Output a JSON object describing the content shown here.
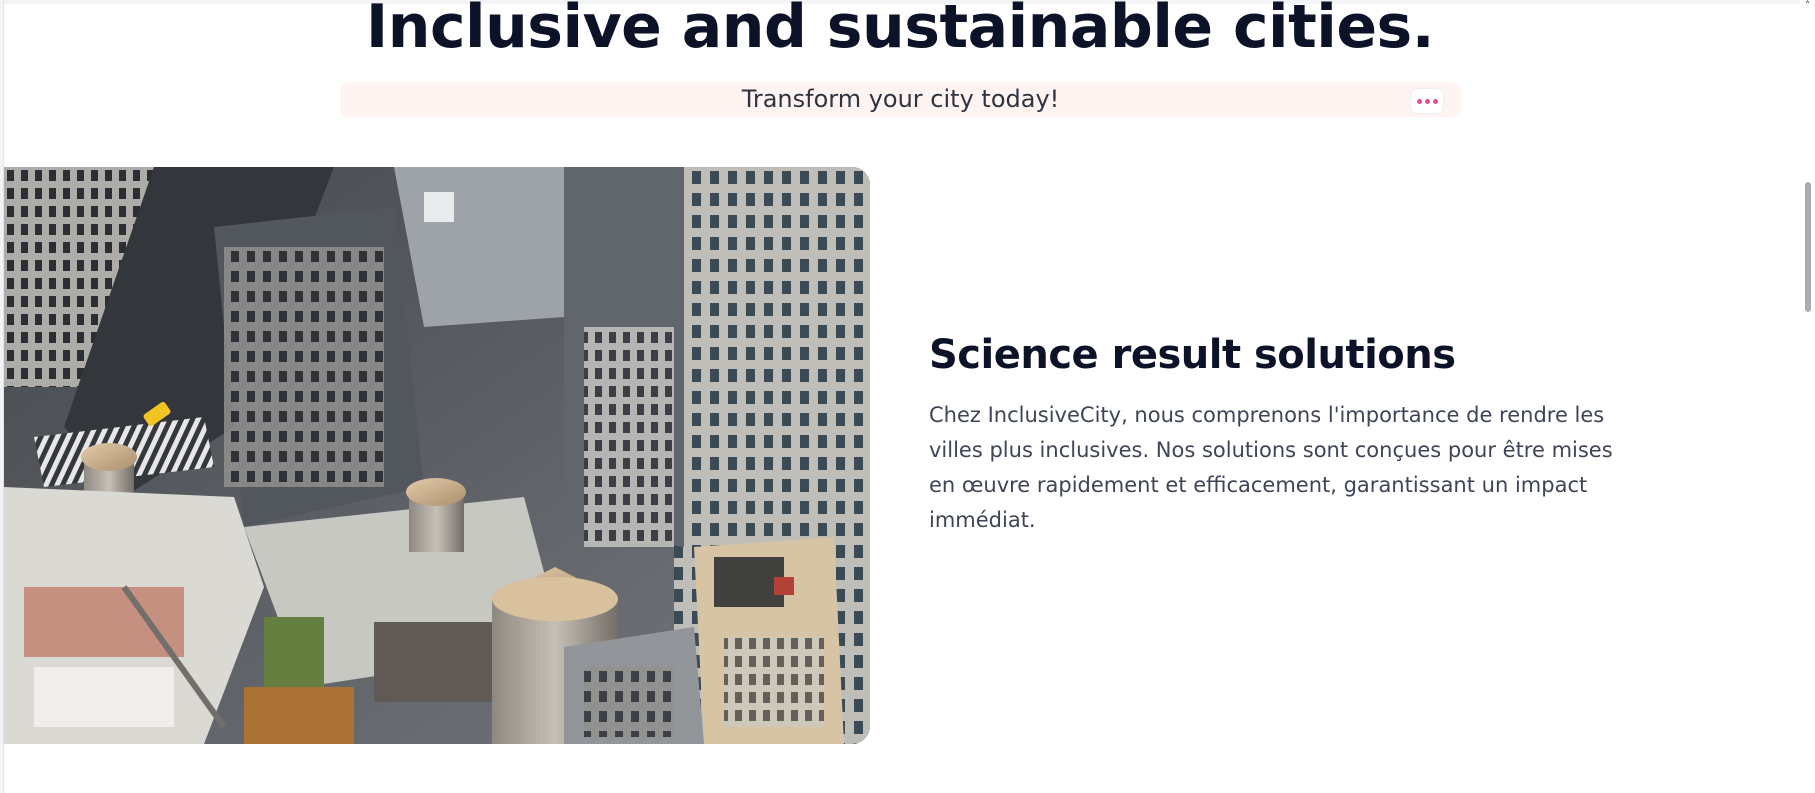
{
  "hero": {
    "title": "Inclusive and sustainable cities."
  },
  "cta": {
    "text": "Transform your city today!",
    "more_icon": "ellipsis-icon",
    "accent_color": "#e34f9a",
    "background_color": "#fff4f2"
  },
  "feature": {
    "image_icon": "city-rooftops-photo",
    "title": "Science result solutions",
    "body": "Chez InclusiveCity, nous comprenons l'importance de rendre les villes plus inclusives. Nos solutions sont conçues pour être mises en œuvre rapidement et efficacement, garantissant un impact immédiat."
  },
  "scrollbar": {
    "up_icon": "chevron-up-icon",
    "up_glyph": "˄"
  },
  "colors": {
    "heading": "#0c1328",
    "body_text": "#3f4556"
  }
}
